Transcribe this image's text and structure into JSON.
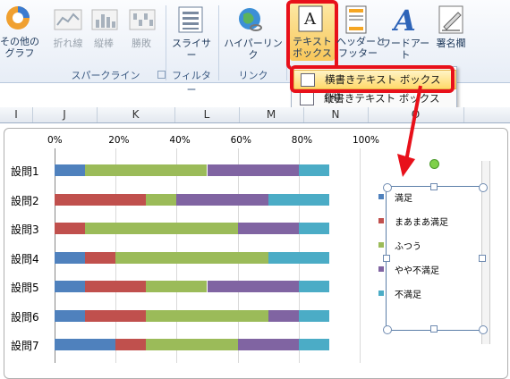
{
  "ribbon": {
    "buttons": {
      "other_graph": "その他の\nグラフ",
      "line": "折れ線",
      "column": "縦棒",
      "winloss": "勝敗",
      "slicer": "スライサー",
      "hyperlink": "ハイパーリンク",
      "textbox": "テキスト\nボックス",
      "header_footer": "ヘッダーと\nフッター",
      "wordart": "ワードアート",
      "signature": "署名欄"
    },
    "groups": {
      "sparkline": "スパークライン",
      "filter": "フィルター",
      "link": "リンク"
    }
  },
  "menu": {
    "items": [
      {
        "label": "横書きテキスト ボックス(H)",
        "highlighted": true
      },
      {
        "label": "縦書きテキスト ボックス(V)",
        "highlighted": false
      }
    ]
  },
  "columns": [
    "I",
    "J",
    "K",
    "L",
    "M",
    "N",
    "O"
  ],
  "colors": {
    "satisfied": "#4f81bd",
    "somewhat_satisfied": "#c0504d",
    "neutral": "#9bbb59",
    "somewhat_dissatisfied": "#8064a2",
    "dissatisfied": "#4bacc6",
    "highlight_red": "#e8101a"
  },
  "chart_data": {
    "type": "bar",
    "stacked": "percent",
    "orientation": "horizontal",
    "categories": [
      "設問1",
      "設問2",
      "設問3",
      "設問4",
      "設問5",
      "設問6",
      "設問7"
    ],
    "xticks": [
      "0%",
      "20%",
      "40%",
      "60%",
      "80%",
      "100%"
    ],
    "xlim": [
      0,
      100
    ],
    "series": [
      {
        "name": "満足",
        "color": "#4f81bd",
        "values": [
          10,
          0,
          0,
          10,
          10,
          10,
          20
        ]
      },
      {
        "name": "まあまあ満足",
        "color": "#c0504d",
        "values": [
          0,
          30,
          10,
          10,
          20,
          20,
          10
        ]
      },
      {
        "name": "ふつう",
        "color": "#9bbb59",
        "values": [
          40,
          10,
          50,
          50,
          20,
          40,
          30
        ]
      },
      {
        "name": "やや不満足",
        "color": "#8064a2",
        "values": [
          30,
          30,
          20,
          0,
          30,
          10,
          20
        ]
      },
      {
        "name": "不満足",
        "color": "#4bacc6",
        "values": [
          10,
          20,
          10,
          20,
          10,
          10,
          10
        ]
      }
    ]
  }
}
